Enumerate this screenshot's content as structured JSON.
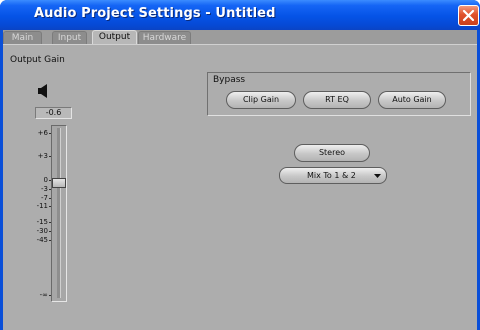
{
  "window": {
    "title": "Audio Project Settings - Untitled"
  },
  "tabs": [
    {
      "label": "Main",
      "active": false
    },
    {
      "label": "Input",
      "active": false
    },
    {
      "label": "Output",
      "active": true
    },
    {
      "label": "Hardware",
      "active": false
    }
  ],
  "output_gain": {
    "label": "Output Gain",
    "value": "-0.6",
    "scale": [
      "+6",
      "+3",
      "0",
      "-3",
      "-7",
      "-11",
      "-15",
      "-30",
      "-45",
      "-∞"
    ],
    "level_fraction": 0.33
  },
  "bypass": {
    "label": "Bypass",
    "buttons": [
      "Clip Gain",
      "RT EQ",
      "Auto Gain"
    ]
  },
  "stereo_button": "Stereo",
  "mix_dropdown": {
    "value": "Mix To 1 & 2"
  },
  "colors": {
    "titlebar": "#0553e6",
    "close_button": "#e0512b",
    "panel": "#adadad"
  },
  "icons": {
    "speaker": "speaker-icon",
    "close": "close-icon",
    "dropdown": "dropdown-arrow-icon"
  }
}
